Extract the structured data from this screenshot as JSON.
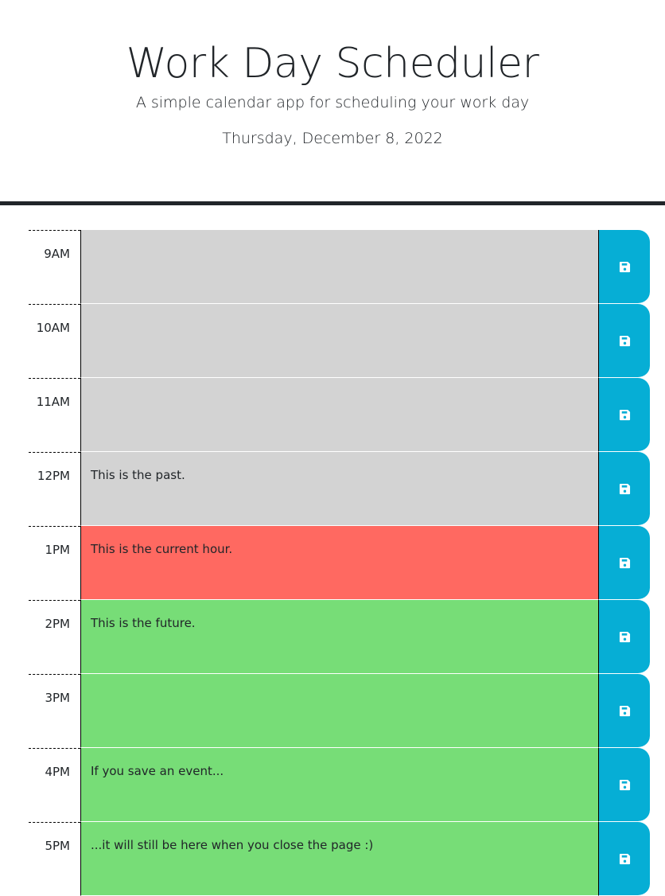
{
  "header": {
    "title": "Work Day Scheduler",
    "subtitle": "A simple calendar app for scheduling your work day",
    "current_day": "Thursday, December 8, 2022"
  },
  "time_blocks": [
    {
      "hour": "9AM",
      "text": "",
      "status": "past",
      "save_icon": "floppy-disk-icon"
    },
    {
      "hour": "10AM",
      "text": "",
      "status": "past",
      "save_icon": "floppy-disk-icon"
    },
    {
      "hour": "11AM",
      "text": "",
      "status": "past",
      "save_icon": "floppy-disk-icon"
    },
    {
      "hour": "12PM",
      "text": "This is the past.",
      "status": "past",
      "save_icon": "floppy-disk-icon"
    },
    {
      "hour": "1PM",
      "text": "This is the current hour.",
      "status": "present",
      "save_icon": "floppy-disk-icon"
    },
    {
      "hour": "2PM",
      "text": "This is the future.",
      "status": "future",
      "save_icon": "floppy-disk-icon"
    },
    {
      "hour": "3PM",
      "text": "",
      "status": "future",
      "save_icon": "floppy-disk-icon"
    },
    {
      "hour": "4PM",
      "text": "If you save an event...",
      "status": "future",
      "save_icon": "floppy-disk-icon"
    },
    {
      "hour": "5PM",
      "text": "...it will still be here when you close the page :)",
      "status": "future",
      "save_icon": "floppy-disk-icon"
    }
  ],
  "colors": {
    "past": "#d3d3d3",
    "present": "#ff6961",
    "future": "#77dd77",
    "save_button": "#06aed5",
    "header_border": "#212529"
  }
}
